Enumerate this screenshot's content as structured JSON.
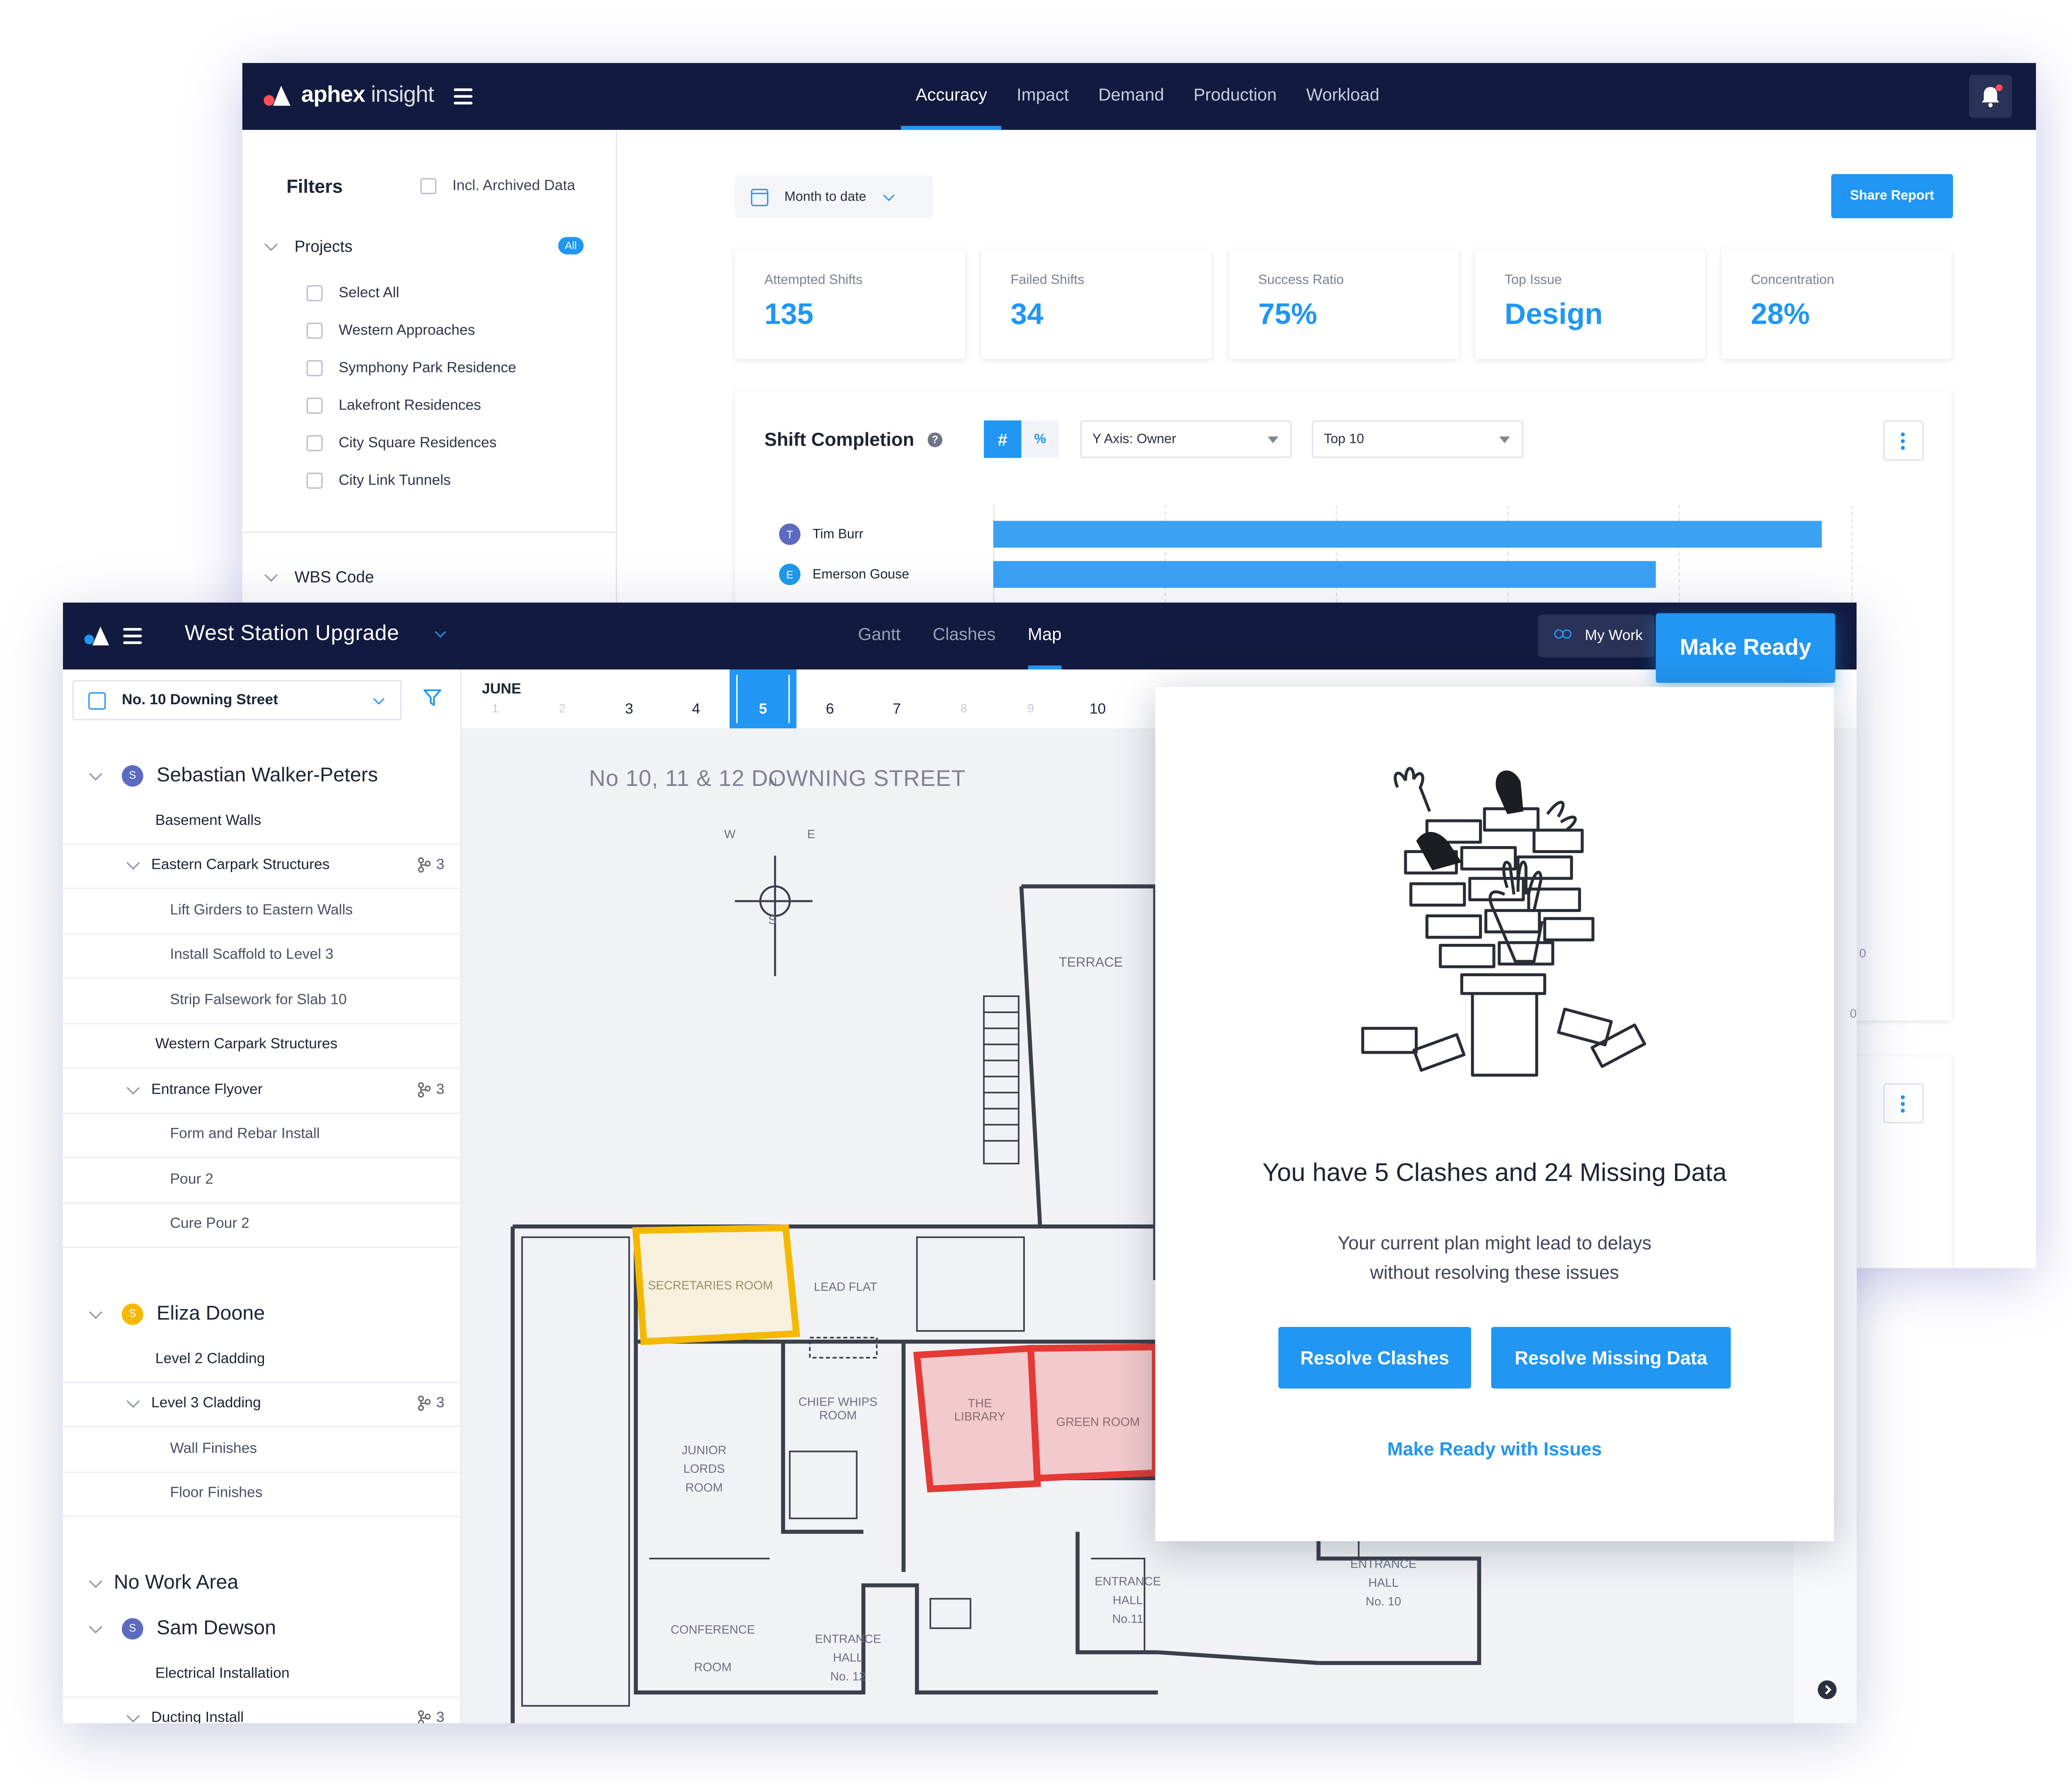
{
  "back_app": {
    "brand_bold": "aphex",
    "brand_light": "insight",
    "nav": [
      "Accuracy",
      "Impact",
      "Demand",
      "Production",
      "Workload"
    ],
    "active_nav": "Accuracy",
    "filters": {
      "title": "Filters",
      "archived_label": "Incl. Archived Data",
      "projects_label": "Projects",
      "all_badge": "All",
      "projects": [
        "Select All",
        "Western Approaches",
        "Symphony Park Residence",
        "Lakefront Residences",
        "City Square Residences",
        "City Link Tunnels"
      ],
      "wbs_label": "WBS Code"
    },
    "date_range": "Month to date",
    "share_button": "Share Report",
    "kpis": [
      {
        "label": "Attempted Shifts",
        "value": "135"
      },
      {
        "label": "Failed Shifts",
        "value": "34"
      },
      {
        "label": "Success Ratio",
        "value": "75%"
      },
      {
        "label": "Top Issue",
        "value": "Design"
      },
      {
        "label": "Concentration",
        "value": "28%"
      }
    ],
    "chart_panel": {
      "title": "Shift Completion",
      "help": "?",
      "mode_hash": "#",
      "mode_pct": "%",
      "y_axis_select": "Y Axis: Owner",
      "top_select": "Top 10",
      "stray_label": "0"
    }
  },
  "chart_data": {
    "type": "bar",
    "title": "Shift Completion",
    "orientation": "horizontal",
    "categories": [
      "Tim Burr",
      "Emerson Gouse"
    ],
    "avatars": [
      "T",
      "E"
    ],
    "values": [
      0.96,
      0.767
    ],
    "value_note": "relative bar length; axis values not visible"
  },
  "front_app": {
    "project_title": "West Station Upgrade",
    "nav": [
      "Gantt",
      "Clashes",
      "Map"
    ],
    "active_nav": "Map",
    "my_work": "My Work",
    "make_ready": "Make Ready",
    "location_select": "No. 10 Downing Street",
    "calendar": {
      "month": "JUNE",
      "days": [
        {
          "n": "1",
          "dim": true
        },
        {
          "n": "2",
          "dim": true
        },
        {
          "n": "3",
          "dim": false
        },
        {
          "n": "4",
          "dim": false
        },
        {
          "n": "5",
          "dim": false,
          "today": true
        },
        {
          "n": "6",
          "dim": false
        },
        {
          "n": "7",
          "dim": false
        },
        {
          "n": "8",
          "dim": true
        },
        {
          "n": "9",
          "dim": true
        },
        {
          "n": "10",
          "dim": false
        }
      ]
    },
    "tree": [
      {
        "type": "person",
        "avatar": "S",
        "color": "#5c6bc0",
        "label": "Sebastian Walker-Peters"
      },
      {
        "type": "task",
        "indent": 1,
        "label": "Basement Walls"
      },
      {
        "type": "group",
        "indent": 1,
        "label": "Eastern Carpark Structures",
        "count": "3"
      },
      {
        "type": "task",
        "indent": 2,
        "label": "Lift Girders to Eastern Walls"
      },
      {
        "type": "task",
        "indent": 2,
        "label": "Install Scaffold to Level 3"
      },
      {
        "type": "task",
        "indent": 2,
        "label": "Strip Falsework for Slab 10"
      },
      {
        "type": "task",
        "indent": 1,
        "label": "Western Carpark Structures"
      },
      {
        "type": "group",
        "indent": 1,
        "label": "Entrance Flyover",
        "count": "3"
      },
      {
        "type": "task",
        "indent": 2,
        "label": "Form and Rebar Install"
      },
      {
        "type": "task",
        "indent": 2,
        "label": "Pour 2"
      },
      {
        "type": "task",
        "indent": 2,
        "label": "Cure Pour 2"
      },
      {
        "type": "person",
        "avatar": "S",
        "color": "#f5b800",
        "label": "Eliza Doone"
      },
      {
        "type": "task",
        "indent": 1,
        "label": "Level 2 Cladding"
      },
      {
        "type": "group",
        "indent": 1,
        "label": "Level 3 Cladding",
        "count": "3"
      },
      {
        "type": "task",
        "indent": 2,
        "label": "Wall Finishes"
      },
      {
        "type": "task",
        "indent": 2,
        "label": "Floor Finishes"
      },
      {
        "type": "area",
        "label": "No Work Area"
      },
      {
        "type": "person",
        "avatar": "S",
        "color": "#5c6bc0",
        "label": "Sam Dewson"
      },
      {
        "type": "task",
        "indent": 1,
        "label": "Electrical Installation"
      },
      {
        "type": "group",
        "indent": 1,
        "label": "Ducting Install",
        "count": "3"
      }
    ],
    "map": {
      "title": "No 10, 11 & 12 DOWNING STREET",
      "compass": {
        "n": "N",
        "s": "S",
        "e": "E",
        "w": "W"
      },
      "rooms": [
        "TERRACE",
        "SECRETARIES ROOM",
        "LEAD FLAT",
        "CHIEF WHIPS",
        "ROOM",
        "THE",
        "LIBRARY",
        "GREEN ROOM",
        "JUNIOR",
        "LORDS",
        "ROOM",
        "CONFERENCE",
        "ROOM",
        "ENTRANCE",
        "HALL",
        "No. 12",
        "ENTRANCE",
        "HALL",
        "No.11",
        "ENTRANCE",
        "HALL",
        "No. 10"
      ],
      "highlight_colors": {
        "clash": "#e53935",
        "missing_data": "#f5b800"
      }
    },
    "side_stray_label": "0"
  },
  "popup": {
    "title": "You have 5 Clashes and 24 Missing Data",
    "text_line1": "Your current plan might lead to delays",
    "text_line2": "without resolving these issues",
    "btn_clashes": "Resolve Clashes",
    "btn_missing": "Resolve Missing Data",
    "link": "Make Ready with Issues"
  },
  "colors": {
    "navy": "#121a3f",
    "accent": "#2196f3",
    "clash_red": "#e53935",
    "missing_yellow": "#f5b800"
  }
}
